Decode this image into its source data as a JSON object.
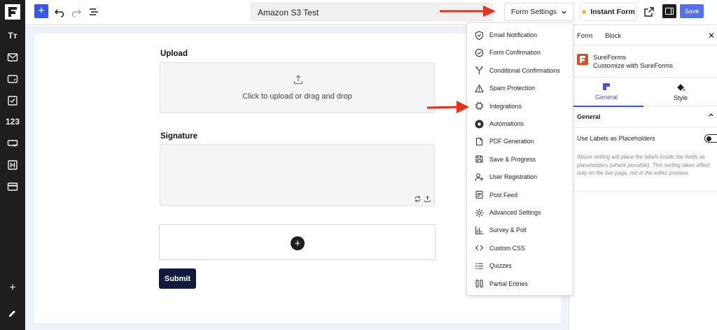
{
  "app": {
    "accent_color": "#3858e9",
    "rail_color": "#1e1e1e",
    "brand_color": "#d9501e"
  },
  "left_rail": {
    "number_icon_label": "123",
    "items": [
      "text-icon",
      "envelope-icon",
      "phone-icon",
      "checkbox-icon",
      "number-icon",
      "dropdown-icon",
      "heading-icon",
      "payment-icon"
    ]
  },
  "topbar": {
    "form_title": "Amazon S3 Test",
    "form_settings_label": "Form Settings",
    "instant_form_label": "Instant Form",
    "save_label": "Save"
  },
  "canvas": {
    "upload_label": "Upload",
    "upload_hint": "Click to upload or drag and drop",
    "signature_label": "Signature",
    "submit_label": "Submit"
  },
  "menu": {
    "items": [
      {
        "label": "Email Notification",
        "icon": "shield-check-icon"
      },
      {
        "label": "Form Confirmation",
        "icon": "check-circle-icon"
      },
      {
        "label": "Conditional Confirmations",
        "icon": "fork-icon"
      },
      {
        "label": "Spam Protection",
        "icon": "warning-icon"
      },
      {
        "label": "Integrations",
        "icon": "chip-icon"
      },
      {
        "label": "Automations",
        "icon": "automation-icon"
      },
      {
        "label": "PDF Generation",
        "icon": "document-icon"
      },
      {
        "label": "Save & Progress",
        "icon": "save-icon"
      },
      {
        "label": "User Registration",
        "icon": "user-plus-icon"
      },
      {
        "label": "Post Feed",
        "icon": "post-icon"
      },
      {
        "label": "Advanced Settings",
        "icon": "gear-icon"
      },
      {
        "label": "Survey & Poll",
        "icon": "chart-icon"
      },
      {
        "label": "Custom CSS",
        "icon": "code-icon"
      },
      {
        "label": "Quizzes",
        "icon": "list-icon"
      },
      {
        "label": "Partial Entries",
        "icon": "columns-icon"
      }
    ]
  },
  "sidebar": {
    "tab_form": "Form",
    "tab_block": "Block",
    "brand_name": "SureForms",
    "brand_sub": "Customize with SureForms",
    "subtab_general": "General",
    "subtab_style": "Style",
    "section_title": "General",
    "toggle_label": "Use Labels as Placeholders",
    "help_text": "Above setting will place the labels inside the fields as placeholders (where possible). This setting takes effect only on the live page, not in the editor preview.",
    "toggle_on": false
  }
}
